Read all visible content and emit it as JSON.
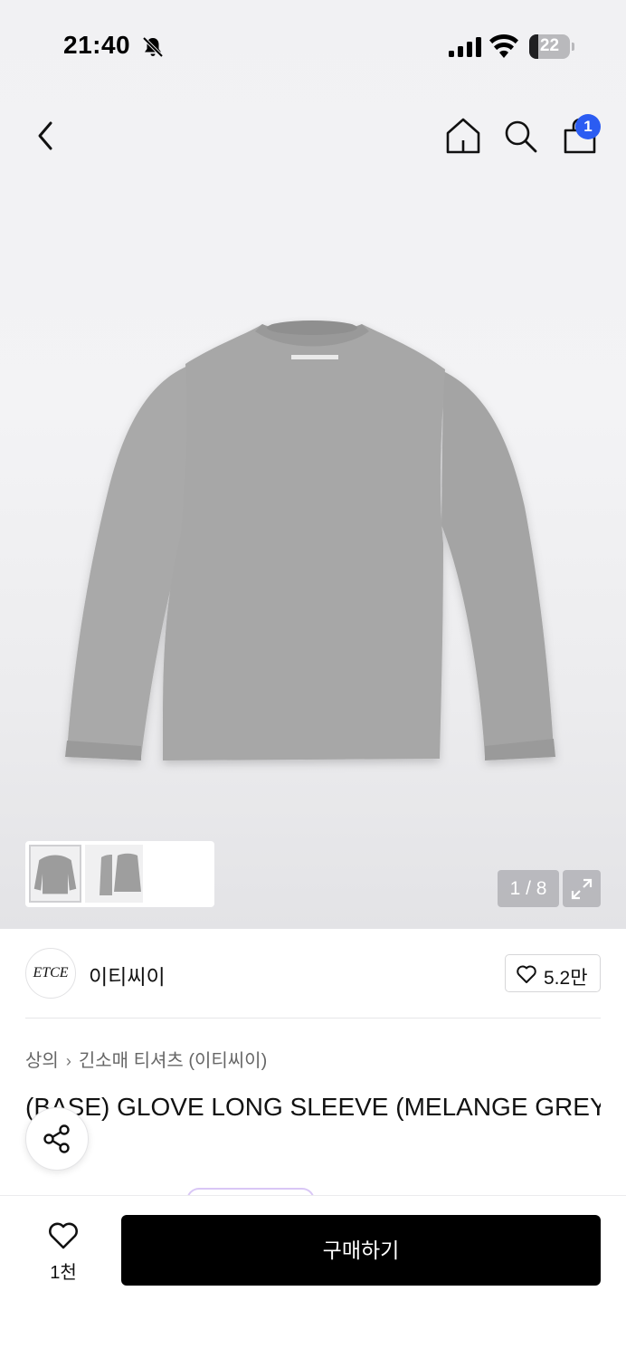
{
  "status_bar": {
    "time": "21:40",
    "battery": "22",
    "battery_level": 0.22
  },
  "nav": {
    "cart_badge": "1",
    "icons": [
      "back-icon",
      "home-icon",
      "search-icon",
      "cart-icon"
    ]
  },
  "gallery": {
    "counter": "1 / 8",
    "current_index": 1,
    "total": 8
  },
  "brand": {
    "logo_text": "ETCE",
    "name": "이티씨이",
    "like_count": "5.2만"
  },
  "breadcrumb": {
    "category": "상의",
    "subcategory": "긴소매 티셔츠 (이티씨이)"
  },
  "product": {
    "title": "(BASE) GLOVE LONG SLEEVE (MELANGE GREY)"
  },
  "bottom_bar": {
    "wish_count": "1천",
    "buy_label": "구매하기"
  },
  "colors": {
    "accent_badge": "#2b5cf2",
    "buy_button": "#000000",
    "shirt_grey": "#a6a6a6"
  }
}
